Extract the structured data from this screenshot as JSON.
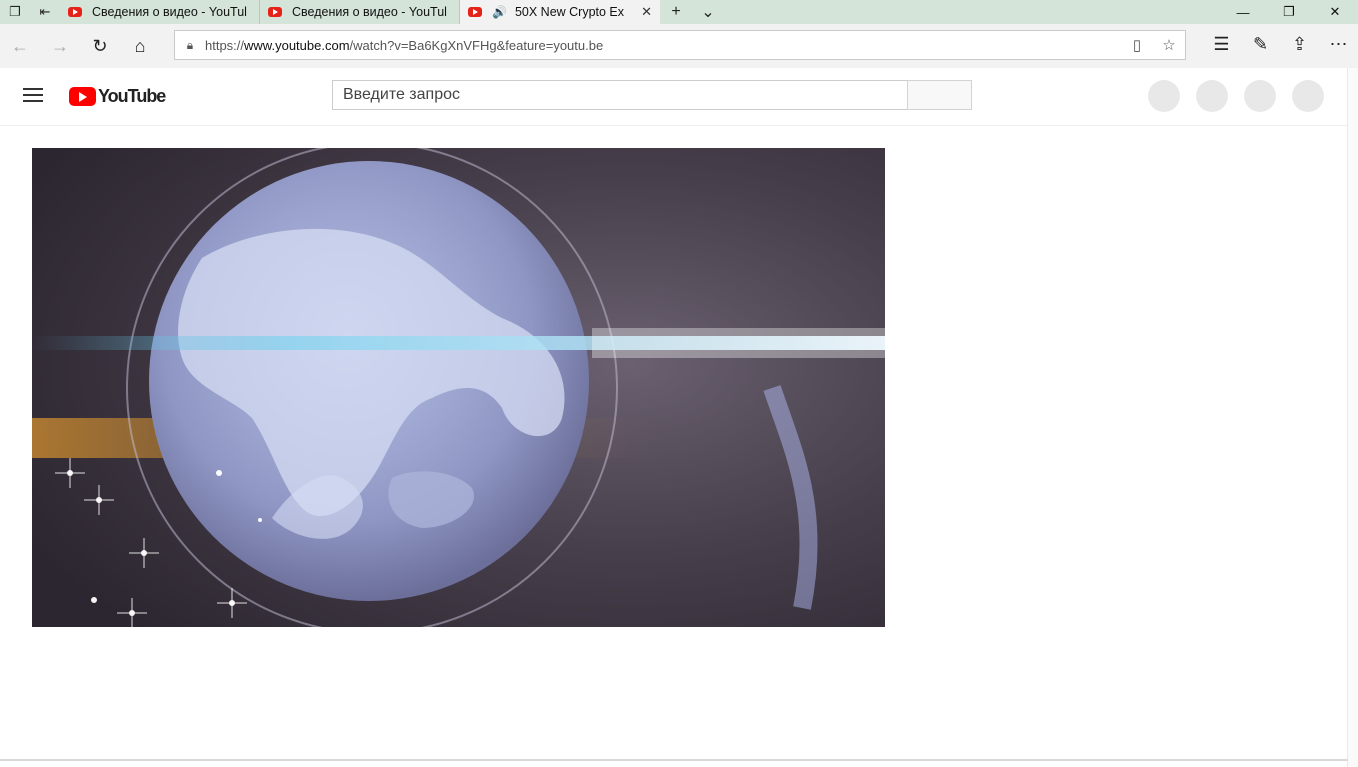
{
  "browser": {
    "tabs": [
      {
        "title": "Сведения о видео - YouTul",
        "active": false
      },
      {
        "title": "Сведения о видео - YouTul",
        "active": false
      },
      {
        "title": "50X New Crypto Ex",
        "active": true
      }
    ],
    "url_prefix": "https://",
    "url_host": "www.youtube.com",
    "url_path": "/watch?v=Ba6KgXnVFHg&feature=youtu.be"
  },
  "youtube": {
    "logo_text": "YouTube",
    "search_placeholder": "Введите запрос"
  },
  "colors": {
    "tabbar": "#d4e4d8",
    "youtube_red": "#ff0000"
  }
}
